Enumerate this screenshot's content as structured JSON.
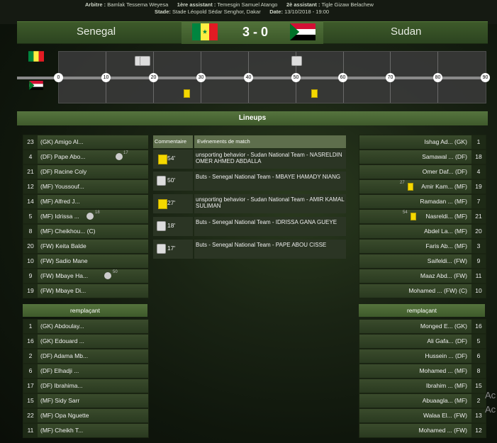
{
  "officials": {
    "referee_label": "Arbitre :",
    "referee": "Bamlak Tessema Weyesa",
    "assistant1_label": "1ère assistant :",
    "assistant1": "Temesgin Samuel Atango",
    "assistant2_label": "2è assistant :",
    "assistant2": "Tigle Gizaw Belachew",
    "stadium_label": "Stade:",
    "stadium": "Stade Léopold Sédar Senghor, Dakar",
    "date_label": "Date:",
    "date": "13/10/2018 - 19:00"
  },
  "match": {
    "home": "Senegal",
    "away": "Sudan",
    "score": "3 - 0"
  },
  "timeline": {
    "ticks": [
      "0",
      "10",
      "20",
      "30",
      "40",
      "50",
      "60",
      "70",
      "80",
      "90"
    ]
  },
  "lineups_title": "Lineups",
  "home_players": [
    {
      "num": "23",
      "name": "(GK) Amigo Al..."
    },
    {
      "num": "4",
      "name": "(DF) Pape Abo...",
      "event": "goal",
      "minute": "17"
    },
    {
      "num": "21",
      "name": "(DF) Racine Coly"
    },
    {
      "num": "12",
      "name": "(MF) Youssouf..."
    },
    {
      "num": "14",
      "name": "(MF) Alfred J..."
    },
    {
      "num": "5",
      "name": "(MF) Idrissa ...",
      "event": "goal",
      "minute": "18"
    },
    {
      "num": "8",
      "name": "(MF) Cheikhou... (C)"
    },
    {
      "num": "20",
      "name": "(FW) Keita Balde"
    },
    {
      "num": "10",
      "name": "(FW) Sadio Mane"
    },
    {
      "num": "9",
      "name": "(FW) Mbaye Ha...",
      "event": "goal",
      "minute": "50"
    },
    {
      "num": "19",
      "name": "(FW) Mbaye Di..."
    }
  ],
  "away_players": [
    {
      "num": "1",
      "name": "Ishag Ad... (GK)"
    },
    {
      "num": "18",
      "name": "Samawal ... (DF)"
    },
    {
      "num": "4",
      "name": "Omer Daf... (DF)"
    },
    {
      "num": "19",
      "name": "Amir Kam... (MF)",
      "event": "card",
      "minute": "27"
    },
    {
      "num": "7",
      "name": "Ramadan ... (MF)"
    },
    {
      "num": "21",
      "name": "Nasreldi... (MF)",
      "event": "card",
      "minute": "54"
    },
    {
      "num": "20",
      "name": "Abdel La... (MF)"
    },
    {
      "num": "3",
      "name": "Faris Ab... (MF)"
    },
    {
      "num": "9",
      "name": "Saifeldi... (FW)"
    },
    {
      "num": "11",
      "name": "Maaz Abd... (FW)"
    },
    {
      "num": "10",
      "name": "Mohamed ... (FW) (C)"
    }
  ],
  "subs_label": "remplaçant",
  "home_subs": [
    {
      "num": "1",
      "name": "(GK) Abdoulay..."
    },
    {
      "num": "16",
      "name": "(GK) Edouard ..."
    },
    {
      "num": "2",
      "name": "(DF) Adama Mb..."
    },
    {
      "num": "6",
      "name": "(DF) Elhadji ..."
    },
    {
      "num": "17",
      "name": "(DF) Ibrahima..."
    },
    {
      "num": "15",
      "name": "(MF) Sidy Sarr"
    },
    {
      "num": "22",
      "name": "(MF) Opa Nguette"
    },
    {
      "num": "11",
      "name": "(MF) Cheikh T..."
    }
  ],
  "away_subs": [
    {
      "num": "16",
      "name": "Monged E... (GK)"
    },
    {
      "num": "5",
      "name": "Ali Gafa... (DF)"
    },
    {
      "num": "6",
      "name": "Hussein ... (DF)"
    },
    {
      "num": "8",
      "name": "Mohamed ... (MF)"
    },
    {
      "num": "15",
      "name": "Ibrahim ... (MF)"
    },
    {
      "num": "2",
      "name": "Abuaagla... (MF)"
    },
    {
      "num": "13",
      "name": "Walaa El... (FW)"
    },
    {
      "num": "12",
      "name": "Mohamed ... (FW)"
    }
  ],
  "events_header": {
    "commentary": "Commentaire",
    "events": "Evénements de match"
  },
  "events": [
    {
      "type": "card",
      "minute": "54'",
      "text": "unsporting behavior - Sudan National Team - NASRELDIN OMER AHMED ABDALLA"
    },
    {
      "type": "goal",
      "minute": "50'",
      "text": "Buts - Senegal National Team - MBAYE HAMADY NIANG"
    },
    {
      "type": "card",
      "minute": "27'",
      "text": "unsporting behavior - Sudan National Team - AMIR KAMAL SULIMAN"
    },
    {
      "type": "goal",
      "minute": "18'",
      "text": "Buts - Senegal National Team - IDRISSA GANA GUEYE"
    },
    {
      "type": "goal",
      "minute": "17'",
      "text": "Buts - Senegal National Team - PAPE ABOU CISSE"
    }
  ],
  "watermark": "Ac\nAc",
  "colors": {
    "yellow_card": "#f5d800",
    "bar_green": "#4f6d38"
  }
}
